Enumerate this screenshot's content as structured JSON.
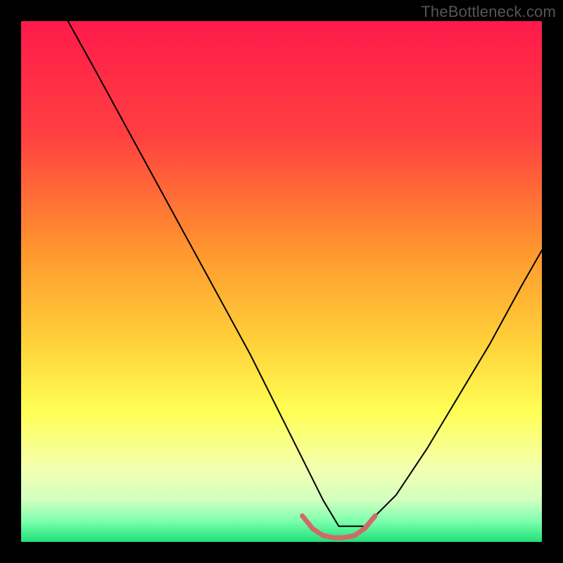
{
  "watermark": "TheBottleneck.com",
  "chart_data": {
    "type": "line",
    "title": "",
    "xlabel": "",
    "ylabel": "",
    "xlim": [
      0,
      100
    ],
    "ylim": [
      0,
      100
    ],
    "gradient_stops": [
      {
        "offset": 0,
        "color": "#ff1a4b"
      },
      {
        "offset": 22,
        "color": "#ff4040"
      },
      {
        "offset": 45,
        "color": "#ff9a2e"
      },
      {
        "offset": 62,
        "color": "#ffd23a"
      },
      {
        "offset": 75,
        "color": "#ffff55"
      },
      {
        "offset": 86,
        "color": "#f3ffb0"
      },
      {
        "offset": 92,
        "color": "#d2ffc0"
      },
      {
        "offset": 96,
        "color": "#7dffad"
      },
      {
        "offset": 100,
        "color": "#20e07a"
      }
    ],
    "series": [
      {
        "name": "bottleneck-curve",
        "stroke": "#000000",
        "stroke_width": 2,
        "x": [
          9,
          14,
          20,
          26,
          32,
          38,
          44,
          49,
          54,
          58,
          61,
          66,
          72,
          78,
          84,
          90,
          96,
          100
        ],
        "values": [
          100,
          91,
          80,
          69,
          58,
          47,
          36,
          26,
          16,
          8,
          3,
          3,
          9,
          18,
          28,
          38,
          49,
          56
        ]
      },
      {
        "name": "optimal-zone-marker",
        "stroke": "#d06a6a",
        "stroke_width": 7,
        "x": [
          54,
          56,
          58,
          60,
          62,
          64,
          66,
          68
        ],
        "values": [
          5,
          2.5,
          1.2,
          0.8,
          0.8,
          1.2,
          2.6,
          5
        ]
      }
    ]
  }
}
